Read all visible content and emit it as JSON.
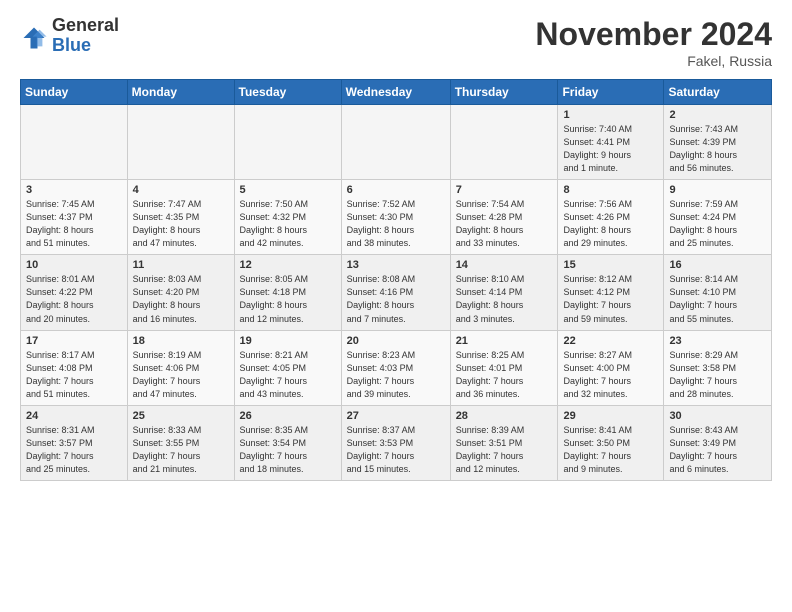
{
  "header": {
    "logo": {
      "general": "General",
      "blue": "Blue"
    },
    "title": "November 2024",
    "location": "Fakel, Russia"
  },
  "days": [
    "Sunday",
    "Monday",
    "Tuesday",
    "Wednesday",
    "Thursday",
    "Friday",
    "Saturday"
  ],
  "weeks": [
    [
      {
        "day": "",
        "info": ""
      },
      {
        "day": "",
        "info": ""
      },
      {
        "day": "",
        "info": ""
      },
      {
        "day": "",
        "info": ""
      },
      {
        "day": "",
        "info": ""
      },
      {
        "day": "1",
        "info": "Sunrise: 7:40 AM\nSunset: 4:41 PM\nDaylight: 9 hours\nand 1 minute."
      },
      {
        "day": "2",
        "info": "Sunrise: 7:43 AM\nSunset: 4:39 PM\nDaylight: 8 hours\nand 56 minutes."
      }
    ],
    [
      {
        "day": "3",
        "info": "Sunrise: 7:45 AM\nSunset: 4:37 PM\nDaylight: 8 hours\nand 51 minutes."
      },
      {
        "day": "4",
        "info": "Sunrise: 7:47 AM\nSunset: 4:35 PM\nDaylight: 8 hours\nand 47 minutes."
      },
      {
        "day": "5",
        "info": "Sunrise: 7:50 AM\nSunset: 4:32 PM\nDaylight: 8 hours\nand 42 minutes."
      },
      {
        "day": "6",
        "info": "Sunrise: 7:52 AM\nSunset: 4:30 PM\nDaylight: 8 hours\nand 38 minutes."
      },
      {
        "day": "7",
        "info": "Sunrise: 7:54 AM\nSunset: 4:28 PM\nDaylight: 8 hours\nand 33 minutes."
      },
      {
        "day": "8",
        "info": "Sunrise: 7:56 AM\nSunset: 4:26 PM\nDaylight: 8 hours\nand 29 minutes."
      },
      {
        "day": "9",
        "info": "Sunrise: 7:59 AM\nSunset: 4:24 PM\nDaylight: 8 hours\nand 25 minutes."
      }
    ],
    [
      {
        "day": "10",
        "info": "Sunrise: 8:01 AM\nSunset: 4:22 PM\nDaylight: 8 hours\nand 20 minutes."
      },
      {
        "day": "11",
        "info": "Sunrise: 8:03 AM\nSunset: 4:20 PM\nDaylight: 8 hours\nand 16 minutes."
      },
      {
        "day": "12",
        "info": "Sunrise: 8:05 AM\nSunset: 4:18 PM\nDaylight: 8 hours\nand 12 minutes."
      },
      {
        "day": "13",
        "info": "Sunrise: 8:08 AM\nSunset: 4:16 PM\nDaylight: 8 hours\nand 7 minutes."
      },
      {
        "day": "14",
        "info": "Sunrise: 8:10 AM\nSunset: 4:14 PM\nDaylight: 8 hours\nand 3 minutes."
      },
      {
        "day": "15",
        "info": "Sunrise: 8:12 AM\nSunset: 4:12 PM\nDaylight: 7 hours\nand 59 minutes."
      },
      {
        "day": "16",
        "info": "Sunrise: 8:14 AM\nSunset: 4:10 PM\nDaylight: 7 hours\nand 55 minutes."
      }
    ],
    [
      {
        "day": "17",
        "info": "Sunrise: 8:17 AM\nSunset: 4:08 PM\nDaylight: 7 hours\nand 51 minutes."
      },
      {
        "day": "18",
        "info": "Sunrise: 8:19 AM\nSunset: 4:06 PM\nDaylight: 7 hours\nand 47 minutes."
      },
      {
        "day": "19",
        "info": "Sunrise: 8:21 AM\nSunset: 4:05 PM\nDaylight: 7 hours\nand 43 minutes."
      },
      {
        "day": "20",
        "info": "Sunrise: 8:23 AM\nSunset: 4:03 PM\nDaylight: 7 hours\nand 39 minutes."
      },
      {
        "day": "21",
        "info": "Sunrise: 8:25 AM\nSunset: 4:01 PM\nDaylight: 7 hours\nand 36 minutes."
      },
      {
        "day": "22",
        "info": "Sunrise: 8:27 AM\nSunset: 4:00 PM\nDaylight: 7 hours\nand 32 minutes."
      },
      {
        "day": "23",
        "info": "Sunrise: 8:29 AM\nSunset: 3:58 PM\nDaylight: 7 hours\nand 28 minutes."
      }
    ],
    [
      {
        "day": "24",
        "info": "Sunrise: 8:31 AM\nSunset: 3:57 PM\nDaylight: 7 hours\nand 25 minutes."
      },
      {
        "day": "25",
        "info": "Sunrise: 8:33 AM\nSunset: 3:55 PM\nDaylight: 7 hours\nand 21 minutes."
      },
      {
        "day": "26",
        "info": "Sunrise: 8:35 AM\nSunset: 3:54 PM\nDaylight: 7 hours\nand 18 minutes."
      },
      {
        "day": "27",
        "info": "Sunrise: 8:37 AM\nSunset: 3:53 PM\nDaylight: 7 hours\nand 15 minutes."
      },
      {
        "day": "28",
        "info": "Sunrise: 8:39 AM\nSunset: 3:51 PM\nDaylight: 7 hours\nand 12 minutes."
      },
      {
        "day": "29",
        "info": "Sunrise: 8:41 AM\nSunset: 3:50 PM\nDaylight: 7 hours\nand 9 minutes."
      },
      {
        "day": "30",
        "info": "Sunrise: 8:43 AM\nSunset: 3:49 PM\nDaylight: 7 hours\nand 6 minutes."
      }
    ]
  ]
}
